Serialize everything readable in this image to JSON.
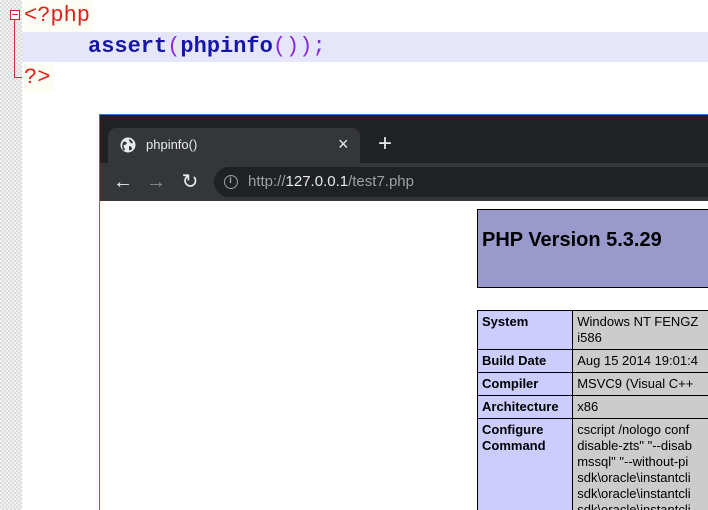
{
  "editor": {
    "line1_open_tag": "<?php",
    "line2": {
      "function_name": "assert",
      "open_paren": "(",
      "inner_function": "phpinfo",
      "inner_parens": "()",
      "close_paren": ")",
      "semicolon": ";"
    },
    "line3_close_tag": "?>",
    "colors": {
      "tag": "#e0201a",
      "function": "#1616a8",
      "punctuation": "#8a2be2",
      "current_line": "#e6e6fa"
    }
  },
  "browser": {
    "tab_title": "phpinfo()",
    "tab_close": "×",
    "new_tab": "+",
    "nav": {
      "back": "←",
      "forward": "→",
      "reload": "↻"
    },
    "url": {
      "scheme": "http://",
      "host": "127.0.0.1",
      "path": "/test7.php"
    },
    "page": {
      "heading": "PHP Version 5.3.29",
      "rows": [
        {
          "label": "System",
          "value": "Windows NT FENGZ\ni586"
        },
        {
          "label": "Build Date",
          "value": "Aug 15 2014 19:01:4"
        },
        {
          "label": "Compiler",
          "value": "MSVC9 (Visual C++"
        },
        {
          "label": "Architecture",
          "value": "x86"
        },
        {
          "label": "Configure\nCommand",
          "value": "cscript /nologo conf\ndisable-zts\" \"--disab\nmssql\" \"--without-pi\nsdk\\oracle\\instantcli\nsdk\\oracle\\instantcli\nsdk\\oracle\\instantcli"
        }
      ],
      "colors": {
        "header_bg": "#9999cc",
        "label_bg": "#ccccff",
        "value_bg": "#cccccc"
      }
    }
  }
}
